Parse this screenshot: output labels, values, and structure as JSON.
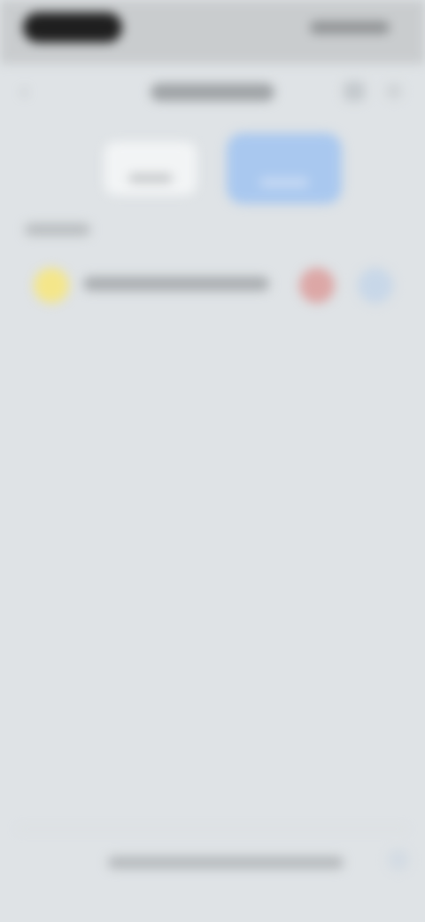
{
  "status_bar": {
    "time": "",
    "indicators": ""
  },
  "header": {
    "title": "",
    "back_icon": "chevron-left-icon",
    "action_icons": [
      "action-icon",
      "more-icon"
    ]
  },
  "segmented": {
    "option_a_label": "",
    "option_b_label": "",
    "selected": "option_b",
    "accent": "#a9c8ef"
  },
  "section": {
    "title": ""
  },
  "list": [
    {
      "label": "",
      "left_icon_color": "#f4e68a",
      "right_icons": [
        {
          "name": "red-action-icon",
          "color": "#dca7a6"
        },
        {
          "name": "blue-action-icon",
          "color": "#c8d7e8"
        }
      ]
    }
  ],
  "background": "#dfe3e6"
}
